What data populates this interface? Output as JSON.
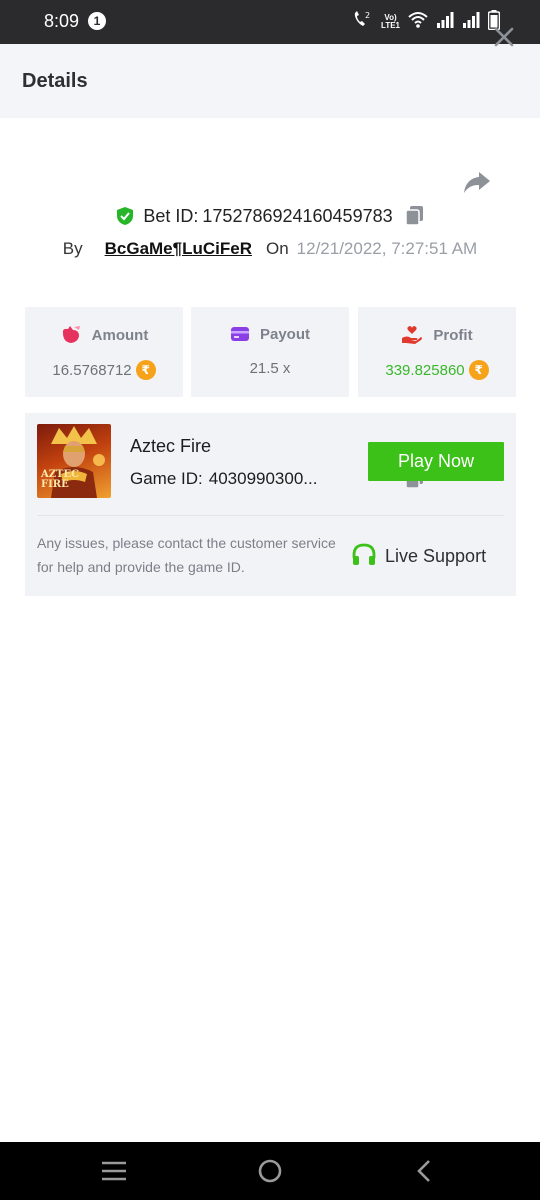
{
  "status_bar": {
    "time": "8:09",
    "notification_count": "1",
    "volte_top": "Vo)",
    "volte_bottom": "LTE1",
    "icons": [
      "wifi-calling-icon",
      "volte-icon",
      "wifi-icon",
      "signal-icon",
      "signal-icon",
      "battery-icon"
    ]
  },
  "header": {
    "title": "Details",
    "close_icon": "close-icon"
  },
  "bet": {
    "share_icon": "share-icon",
    "verified_icon": "shield-check-icon",
    "bet_id_label": "Bet ID:",
    "bet_id": "1752786924160459783",
    "copy_icon": "copy-icon",
    "by_label": "By",
    "username": "BcGaMe¶LuCiFeR",
    "on_label": "On",
    "date": "12/21/2022, 7:27:51 AM"
  },
  "stats": {
    "amount": {
      "label": "Amount",
      "value": "16.5768712",
      "icon": "money-bag-icon"
    },
    "payout": {
      "label": "Payout",
      "value": "21.5 x",
      "icon": "card-icon"
    },
    "profit": {
      "label": "Profit",
      "value": "339.825860",
      "icon": "hand-heart-icon"
    },
    "currency_symbol": "₹"
  },
  "game": {
    "thumbnail_label_line1": "AZTEC",
    "thumbnail_label_line2": "FIRE",
    "name": "Aztec Fire",
    "game_id_label": "Game ID:",
    "game_id": "4030990300...",
    "play_button": "Play Now",
    "help_text": "Any issues, please contact the customer service for help and provide the game ID.",
    "support_label": "Live Support",
    "support_icon": "headset-icon"
  },
  "nav": {
    "icons": [
      "menu-icon",
      "home-circle-icon",
      "back-icon"
    ]
  },
  "colors": {
    "accent_green": "#3bc117",
    "profit_green": "#39b82a",
    "coin_orange": "#f6a31b",
    "amount_icon_pink": "#e6325f",
    "payout_icon_purple": "#8a3fe6",
    "profit_icon_red": "#e03a2e"
  }
}
